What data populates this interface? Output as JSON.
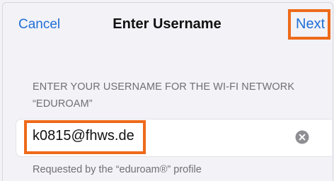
{
  "navbar": {
    "cancel_label": "Cancel",
    "title": "Enter Username",
    "next_label": "Next"
  },
  "section": {
    "header": "ENTER YOUR USERNAME FOR THE WI-FI NETWORK “EDUROAM”"
  },
  "username_field": {
    "value": "k0815@fhws.de",
    "clear_icon": "clear-x-circle-icon"
  },
  "footer": {
    "text": "Requested by the “eduroam®” profile"
  },
  "colors": {
    "accent": "#1f6fd6",
    "highlight": "#ee6a1a",
    "background": "#f2f2f7"
  }
}
